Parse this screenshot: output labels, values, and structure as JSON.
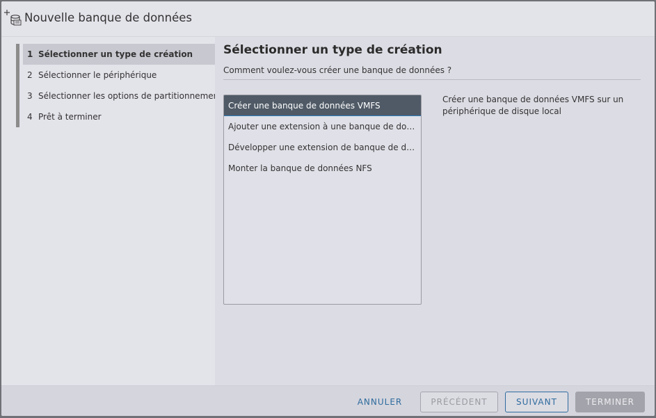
{
  "dialog": {
    "title": "Nouvelle banque de données",
    "title_icon": "new-datastore-icon"
  },
  "steps": [
    {
      "num": "1",
      "label": "Sélectionner un type de création",
      "active": true
    },
    {
      "num": "2",
      "label": "Sélectionner le périphérique",
      "active": false
    },
    {
      "num": "3",
      "label": "Sélectionner les options de partitionnement",
      "active": false
    },
    {
      "num": "4",
      "label": "Prêt à terminer",
      "active": false
    }
  ],
  "main": {
    "title": "Sélectionner un type de création",
    "question": "Comment voulez-vous créer une banque de données ?",
    "options": [
      {
        "label": "Créer une banque de données VMFS",
        "selected": true
      },
      {
        "label": "Ajouter une extension à une banque de données existante",
        "selected": false
      },
      {
        "label": "Développer une extension de banque de données",
        "selected": false
      },
      {
        "label": "Monter la banque de données NFS",
        "selected": false
      }
    ],
    "description": "Créer une banque de données VMFS sur un périphérique de disque local"
  },
  "footer": {
    "cancel": "ANNULER",
    "previous": "PRÉCÉDENT",
    "next": "SUIVANT",
    "finish": "TERMINER"
  },
  "colors": {
    "accent": "#2e6c9e",
    "selected_row": "#4f5a66",
    "disabled_button": "#a3a3ab"
  }
}
